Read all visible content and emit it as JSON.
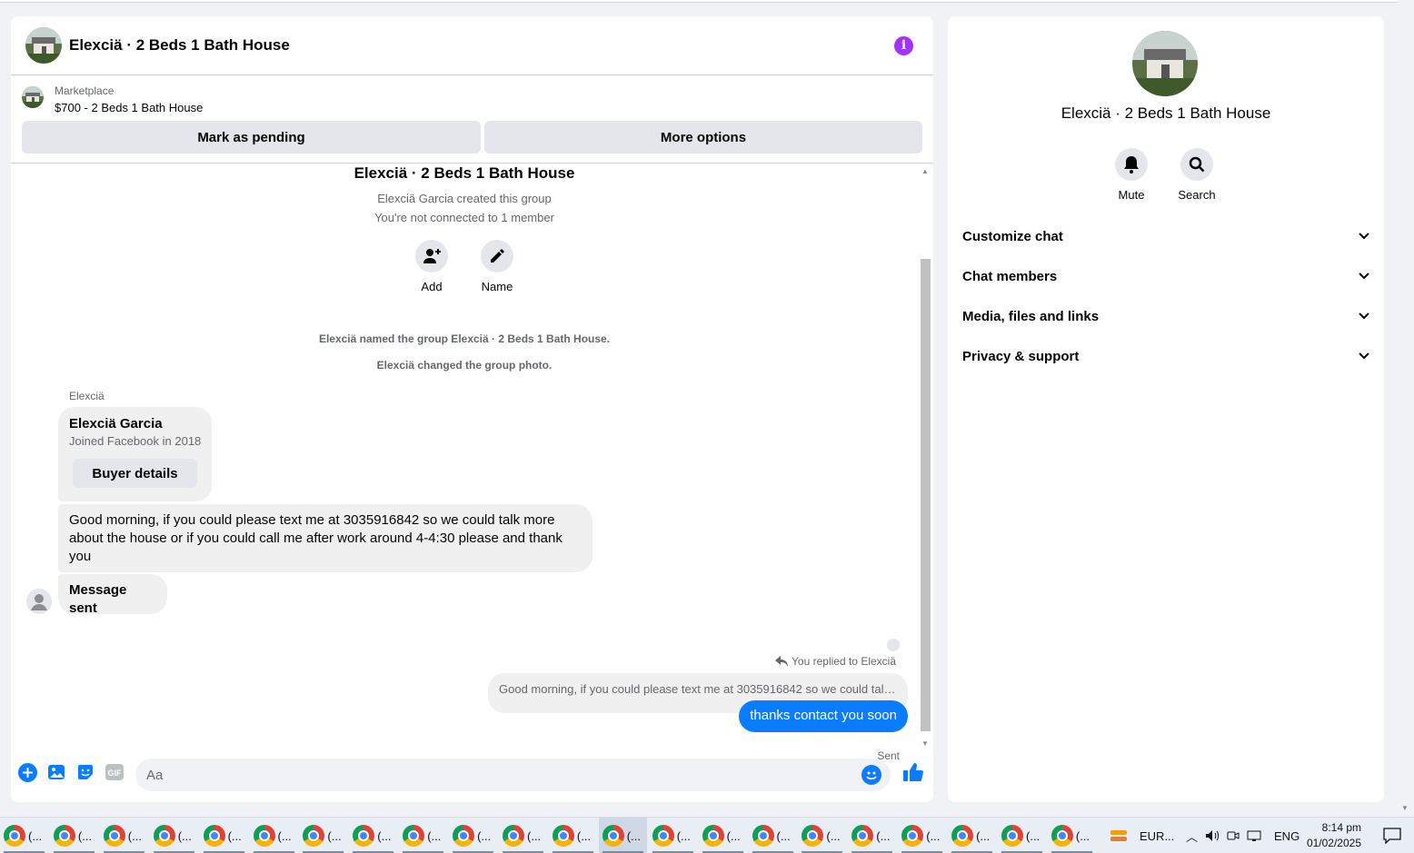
{
  "chat": {
    "title": "Elexciä · 2 Beds 1 Bath House",
    "listing_source": "Marketplace",
    "listing_price": "$700 - 2 Beds 1 Bath House",
    "mark_pending_label": "Mark as pending",
    "more_options_label": "More options"
  },
  "thread": {
    "group_title": "Elexciä · 2 Beds 1 Bath House",
    "created_line": "Elexciä Garcia created this group",
    "not_connected_line": "You're not connected to 1 member",
    "add_label": "Add",
    "name_label": "Name",
    "renamed_event": "Elexciä named the group Elexciä · 2 Beds 1 Bath House.",
    "photo_event": "Elexciä changed the group photo.",
    "sender_name": "Elexciä",
    "buyer_card": {
      "name": "Elexciä Garcia",
      "joined": "Joined Facebook in 2018",
      "button": "Buyer details"
    },
    "incoming_message": "Good morning, if you could please text me at 3035916842 so we could talk more about the house or if you could call me after work around 4-4:30 please and thank you",
    "incoming_message_2": "Message sent",
    "replied_to": "You replied to Elexciä",
    "quoted_message": "Good morning, if you could please text me at 3035916842 so we could talk...",
    "outgoing_message": "thanks contact you soon",
    "status": "Sent"
  },
  "composer": {
    "placeholder": "Aa"
  },
  "details": {
    "title": "Elexciä · 2 Beds 1 Bath House",
    "mute_label": "Mute",
    "search_label": "Search",
    "sections": [
      "Customize chat",
      "Chat members",
      "Media, files and links",
      "Privacy & support"
    ]
  },
  "taskbar": {
    "item_label": "(...",
    "currency_label": "EUR...",
    "language": "ENG",
    "time": "8:14 pm",
    "date": "01/02/2025"
  },
  "colors": {
    "accent_blue": "#0a7cff",
    "info_purple": "#a033ff"
  }
}
